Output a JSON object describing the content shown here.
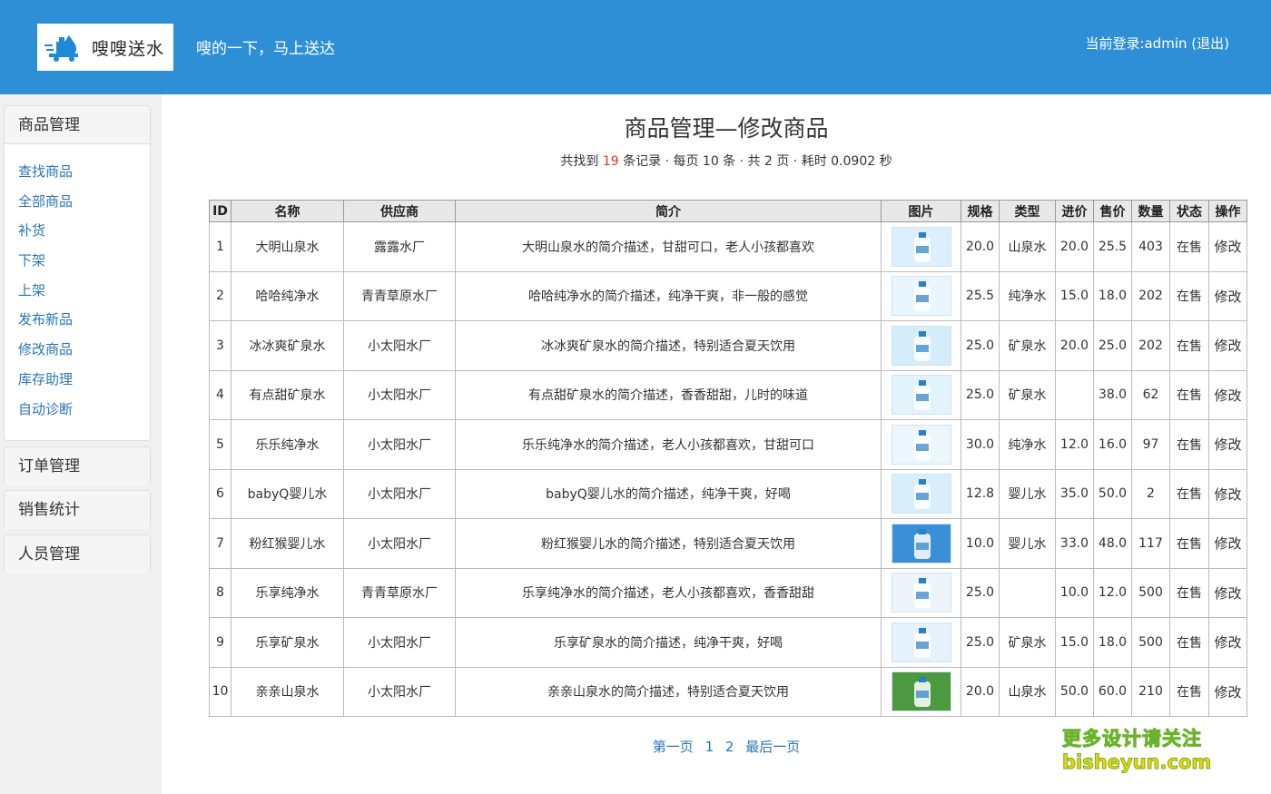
{
  "header": {
    "logo_text": "嗖嗖送水",
    "slogan": "嗖的一下，马上送达",
    "login_prefix": "当前登录:admin",
    "logout_label": "(退出)"
  },
  "sidebar": {
    "product_group": "商品管理",
    "items": [
      "查找商品",
      "全部商品",
      "补货",
      "下架",
      "上架",
      "发布新品",
      "修改商品",
      "库存助理",
      "自动诊断"
    ],
    "order_group": "订单管理",
    "sales_group": "销售统计",
    "staff_group": "人员管理"
  },
  "main": {
    "title": "商品管理—修改商品",
    "summary_prefix": "共找到 ",
    "record_count": "19",
    "summary_suffix": " 条记录 · 每页 10 条 · 共 2 页 · 耗时 0.0902 秒"
  },
  "table": {
    "headers": [
      "ID",
      "名称",
      "供应商",
      "简介",
      "图片",
      "规格",
      "类型",
      "进价",
      "售价",
      "数量",
      "状态",
      "操作"
    ],
    "rows": [
      {
        "id": "1",
        "name": "大明山泉水",
        "supplier": "露露水厂",
        "desc": "大明山泉水的简介描述，甘甜可口，老人小孩都喜欢",
        "spec": "20.0",
        "type": "山泉水",
        "cost": "20.0",
        "price": "25.5",
        "qty": "403",
        "status": "在售",
        "action": "修改"
      },
      {
        "id": "2",
        "name": "哈哈纯净水",
        "supplier": "青青草原水厂",
        "desc": "哈哈纯净水的简介描述，纯净干爽，非一般的感觉",
        "spec": "25.5",
        "type": "纯净水",
        "cost": "15.0",
        "price": "18.0",
        "qty": "202",
        "status": "在售",
        "action": "修改"
      },
      {
        "id": "3",
        "name": "冰冰爽矿泉水",
        "supplier": "小太阳水厂",
        "desc": "冰冰爽矿泉水的简介描述，特别适合夏天饮用",
        "spec": "25.0",
        "type": "矿泉水",
        "cost": "20.0",
        "price": "25.0",
        "qty": "202",
        "status": "在售",
        "action": "修改"
      },
      {
        "id": "4",
        "name": "有点甜矿泉水",
        "supplier": "小太阳水厂",
        "desc": "有点甜矿泉水的简介描述，香香甜甜，儿时的味道",
        "spec": "25.0",
        "type": "矿泉水",
        "cost": "",
        "price": "38.0",
        "qty": "62",
        "status": "在售",
        "action": "修改"
      },
      {
        "id": "5",
        "name": "乐乐纯净水",
        "supplier": "小太阳水厂",
        "desc": "乐乐纯净水的简介描述，老人小孩都喜欢，甘甜可口",
        "spec": "30.0",
        "type": "纯净水",
        "cost": "12.0",
        "price": "16.0",
        "qty": "97",
        "status": "在售",
        "action": "修改"
      },
      {
        "id": "6",
        "name": "babyQ婴儿水",
        "supplier": "小太阳水厂",
        "desc": "babyQ婴儿水的简介描述，纯净干爽，好喝",
        "spec": "12.8",
        "type": "婴儿水",
        "cost": "35.0",
        "price": "50.0",
        "qty": "2",
        "status": "在售",
        "action": "修改"
      },
      {
        "id": "7",
        "name": "粉红猴婴儿水",
        "supplier": "小太阳水厂",
        "desc": "粉红猴婴儿水的简介描述，特别适合夏天饮用",
        "spec": "10.0",
        "type": "婴儿水",
        "cost": "33.0",
        "price": "48.0",
        "qty": "117",
        "status": "在售",
        "action": "修改"
      },
      {
        "id": "8",
        "name": "乐享纯净水",
        "supplier": "青青草原水厂",
        "desc": "乐享纯净水的简介描述，老人小孩都喜欢，香香甜甜",
        "spec": "25.0",
        "type": "",
        "cost": "10.0",
        "price": "12.0",
        "qty": "500",
        "status": "在售",
        "action": "修改"
      },
      {
        "id": "9",
        "name": "乐享矿泉水",
        "supplier": "小太阳水厂",
        "desc": "乐享矿泉水的简介描述，纯净干爽，好喝",
        "spec": "25.0",
        "type": "矿泉水",
        "cost": "15.0",
        "price": "18.0",
        "qty": "500",
        "status": "在售",
        "action": "修改"
      },
      {
        "id": "10",
        "name": "亲亲山泉水",
        "supplier": "小太阳水厂",
        "desc": "亲亲山泉水的简介描述，特别适合夏天饮用",
        "spec": "20.0",
        "type": "山泉水",
        "cost": "50.0",
        "price": "60.0",
        "qty": "210",
        "status": "在售",
        "action": "修改"
      }
    ]
  },
  "pager": {
    "first": "第一页",
    "page1": "1",
    "page2": "2",
    "last": "最后一页"
  },
  "watermark": {
    "line1": "更多设计请关注",
    "line2": "bisheyun.com"
  }
}
